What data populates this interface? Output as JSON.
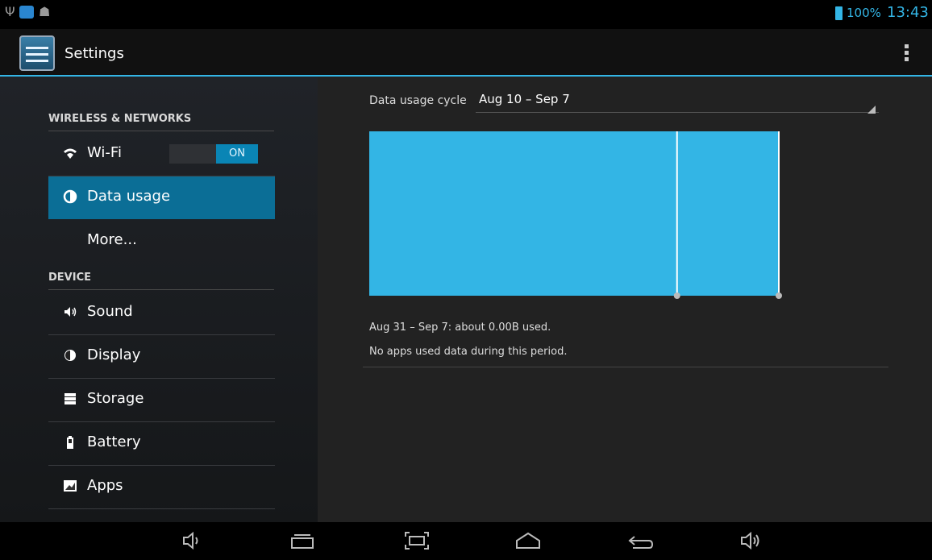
{
  "status_bar": {
    "battery": "100%",
    "time": "13:43",
    "icons": [
      "usb-icon",
      "mail-icon",
      "android-icon",
      "battery-icon"
    ]
  },
  "action_bar": {
    "title": "Settings",
    "icons": [
      "settings-app-icon",
      "overflow-menu-icon"
    ]
  },
  "sidebar": {
    "section_wireless": "WIRELESS & NETWORKS",
    "section_device": "DEVICE",
    "items": [
      {
        "label": "Wi-Fi",
        "icon": "wifi-icon",
        "toggle": "ON"
      },
      {
        "label": "Data usage",
        "icon": "data-usage-icon",
        "selected": true
      },
      {
        "label": "More...",
        "icon": ""
      },
      {
        "label": "Sound",
        "icon": "sound-icon"
      },
      {
        "label": "Display",
        "icon": "display-icon"
      },
      {
        "label": "Storage",
        "icon": "storage-icon"
      },
      {
        "label": "Battery",
        "icon": "battery-settings-icon"
      },
      {
        "label": "Apps",
        "icon": "apps-icon"
      }
    ]
  },
  "data_usage": {
    "cycle_label": "Data usage cycle",
    "cycle_value": "Aug 10 – Sep 7",
    "summary": "Aug 31 – Sep 7: about 0.00B used.",
    "no_apps": "No apps used data during this period."
  },
  "chart_data": {
    "type": "area",
    "period_start": "Aug 10",
    "period_end": "Sep 7",
    "selection_start": "Aug 31",
    "selection_end": "Sep 7",
    "usage_bytes": 0,
    "colors": {
      "fill": "#33b5e5",
      "marker": "#ffffff"
    }
  },
  "navbar": {
    "icons": [
      "volume-down-icon",
      "recent-apps-icon",
      "screenshot-icon",
      "home-icon",
      "back-icon",
      "volume-up-icon"
    ]
  },
  "colors": {
    "accent": "#33b5e5",
    "selected": "#0b6e96"
  }
}
